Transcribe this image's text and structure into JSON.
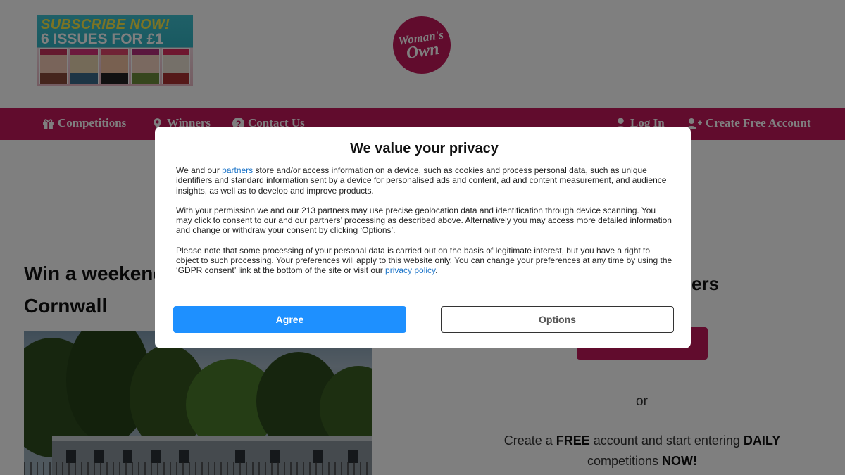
{
  "header": {
    "promo_line1": "SUBSCRIBE NOW!",
    "promo_line2": "6 ISSUES FOR £1",
    "logo_line1": "Woman's",
    "logo_line2": "Own"
  },
  "nav": {
    "left": [
      {
        "label": "Competitions",
        "icon": "gift-icon"
      },
      {
        "label": "Winners",
        "icon": "map-pin-icon"
      },
      {
        "label": "Contact Us",
        "icon": "question-icon"
      }
    ],
    "right": [
      {
        "label": "Log In",
        "icon": "user-icon"
      },
      {
        "label": "Create Free Account",
        "icon": "user-plus-icon"
      }
    ]
  },
  "article": {
    "title_line1": "Win a weekend",
    "title_line2": "Cornwall"
  },
  "sidebar": {
    "heading_fragment": "ers",
    "or": "or",
    "cta_prefix": "Create a ",
    "cta_free": "FREE",
    "cta_mid": " account and start entering ",
    "cta_daily": "DAILY",
    "cta_line2_prefix": "competitions ",
    "cta_now": "NOW!"
  },
  "consent": {
    "title": "We value your privacy",
    "p1_before": "We and our ",
    "p1_link": "partners",
    "p1_after": " store and/or access information on a device, such as cookies and process personal data, such as unique identifiers and standard information sent by a device for personalised ads and content, ad and content measurement, and audience insights, as well as to develop and improve products.",
    "p2": "With your permission we and our 213 partners may use precise geolocation data and identification through device scanning. You may click to consent to our and our partners’ processing as described above. Alternatively you may access more detailed information and change or withdraw your consent by clicking ‘Options’.",
    "p3_before": "Please note that some processing of your personal data is carried out on the basis of legitimate interest, but you have a right to object to such processing. Your preferences will apply to this website only. You can change your preferences at any time by using the ‘GDPR consent’ link at the bottom of the site or visit our ",
    "p3_link": "privacy policy",
    "p3_after": ".",
    "agree": "Agree",
    "options": "Options"
  },
  "colors": {
    "brand": "#c2185b",
    "agree": "#1e90ff",
    "link": "#1a73c8"
  }
}
